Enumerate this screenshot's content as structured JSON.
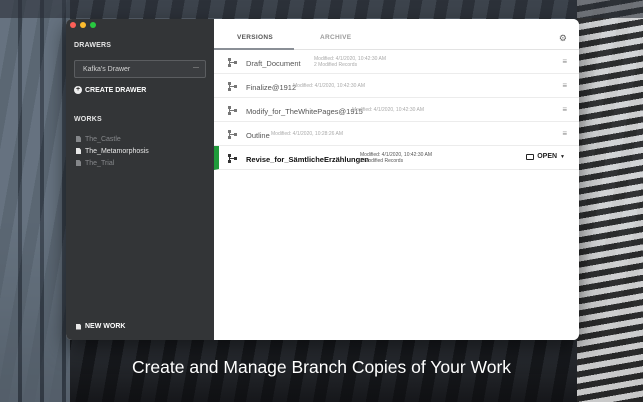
{
  "sidebar": {
    "drawers_heading": "DRAWERS",
    "drawer_select_value": "Kafka's Drawer",
    "create_drawer_label": "CREATE DRAWER",
    "works_heading": "WORKS",
    "works": [
      {
        "label": "The_Castle",
        "active": false
      },
      {
        "label": "The_Metamorphosis",
        "active": true
      },
      {
        "label": "The_Trial",
        "active": false
      }
    ],
    "new_work_label": "NEW WORK"
  },
  "main": {
    "tabs": [
      {
        "label": "VERSIONS",
        "active": true
      },
      {
        "label": "ARCHIVE",
        "active": false
      }
    ],
    "versions": [
      {
        "name": "Draft_Document",
        "modified": "Modified: 4/1/2020, 10:42:30 AM",
        "records": "2 Modified Records",
        "selected": false
      },
      {
        "name": "Finalize@1912",
        "modified": "Modified: 4/1/2020, 10:42:30 AM",
        "records": "",
        "selected": false
      },
      {
        "name": "Modify_for_TheWhitePages@1915",
        "modified": "Modified: 4/1/2020, 10:42:30 AM",
        "records": "",
        "selected": false
      },
      {
        "name": "Outline",
        "modified": "Modified: 4/1/2020, 10:28:26 AM",
        "records": "",
        "selected": false
      },
      {
        "name": "Revise_for_SämtlicheErzählungen",
        "modified": "Modified: 4/1/2020, 10:42:30 AM",
        "records": "2 Modified Records",
        "selected": true
      }
    ],
    "open_label": "OPEN"
  },
  "caption": "Create  and Manage Branch Copies of Your Work",
  "colors": {
    "accent_green": "#1f9b3b",
    "sidebar_bg": "#333537"
  }
}
